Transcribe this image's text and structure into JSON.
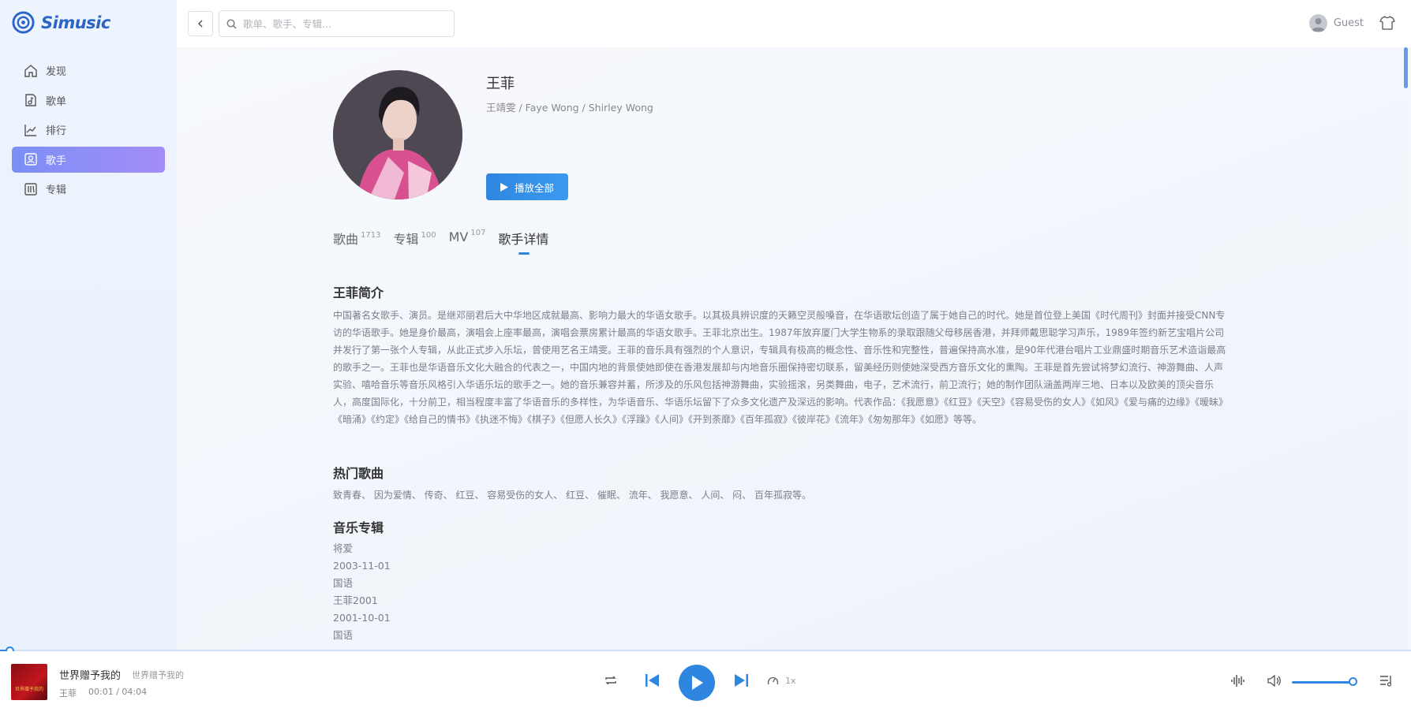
{
  "app": {
    "name": "Simusic"
  },
  "sidebar": {
    "items": [
      {
        "label": "发现",
        "icon": "home-icon"
      },
      {
        "label": "歌单",
        "icon": "playlist-icon"
      },
      {
        "label": "排行",
        "icon": "chart-icon"
      },
      {
        "label": "歌手",
        "icon": "singer-icon",
        "active": true
      },
      {
        "label": "专辑",
        "icon": "album-icon"
      }
    ]
  },
  "topbar": {
    "search_placeholder": "歌单、歌手、专辑...",
    "user_name": "Guest"
  },
  "artist": {
    "name": "王菲",
    "alias": "王靖雯 / Faye Wong / Shirley Wong",
    "play_all_label": "播放全部"
  },
  "tabs": [
    {
      "label": "歌曲",
      "count": "1713"
    },
    {
      "label": "专辑",
      "count": "100"
    },
    {
      "label": "MV",
      "count": "107"
    },
    {
      "label": "歌手详情",
      "count": "",
      "active": true
    }
  ],
  "details": {
    "intro_title": "王菲简介",
    "intro_text": "中国著名女歌手、演员。是继邓丽君后大中华地区成就最高、影响力最大的华语女歌手。以其极具辨识度的天籁空灵般嗓音，在华语歌坛创造了属于她自己的时代。她是首位登上美国《时代周刊》封面并接受CNN专访的华语歌手。她是身价最高，演唱会上座率最高，演唱会票房累计最高的华语女歌手。王菲北京出生。1987年放弃厦门大学生物系的录取跟随父母移居香港，并拜师戴思聪学习声乐，1989年签约新艺宝唱片公司并发行了第一张个人专辑，从此正式步入乐坛，曾使用艺名王靖雯。王菲的音乐具有强烈的个人意识，专辑具有极高的概念性、音乐性和完整性，普遍保持高水准，是90年代港台唱片工业鼎盛时期音乐艺术造诣最高的歌手之一。王菲也是华语音乐文化大融合的代表之一，中国内地的背景使她即使在香港发展却与内地音乐圈保持密切联系，留美经历则使她深受西方音乐文化的熏陶。王菲是首先尝试将梦幻流行、神游舞曲、人声实验、嘻哈音乐等音乐风格引入华语乐坛的歌手之一。她的音乐兼容并蓄，所涉及的乐风包括神游舞曲，实验摇滚，另类舞曲，电子，艺术流行，前卫流行；她的制作团队涵盖两岸三地、日本以及欧美的顶尖音乐人，高度国际化，十分前卫，相当程度丰富了华语音乐的多样性，为华语音乐、华语乐坛留下了众多文化遗产及深远的影响。代表作品：《我愿意》《红豆》《天空》《容易受伤的女人》《如风》《爱与痛的边缘》《暧昧》《暗涌》《约定》《给自己的情书》《执迷不悔》《棋子》《但愿人长久》《浮躁》《人间》《开到荼靡》《百年孤寂》《彼岸花》《流年》《匆匆那年》《如愿》等等。",
    "hot_title": "热门歌曲",
    "hot_text": "致青春、 因为爱情、 传奇、 红豆、 容易受伤的女人、 红豆、 催眠、 流年、 我愿意、 人间、 闷、 百年孤寂等。",
    "albums_title": "音乐专辑",
    "albums": [
      "将爱",
      "2003-11-01",
      "国语",
      "王菲2001",
      "2001-10-01",
      "国语"
    ]
  },
  "player": {
    "song_title": "世界赠予我的",
    "song_subtitle": "世界赠予我的",
    "artist": "王菲",
    "time": "00:01 / 04:04",
    "speed": "1x",
    "progress_fraction": 0.004,
    "volume_fraction": 0.92,
    "cover_text": "世界赠予我的"
  },
  "colors": {
    "accent": "#2f86e0",
    "nav_active_start": "#7b8ff5",
    "nav_active_end": "#a48cf7"
  }
}
